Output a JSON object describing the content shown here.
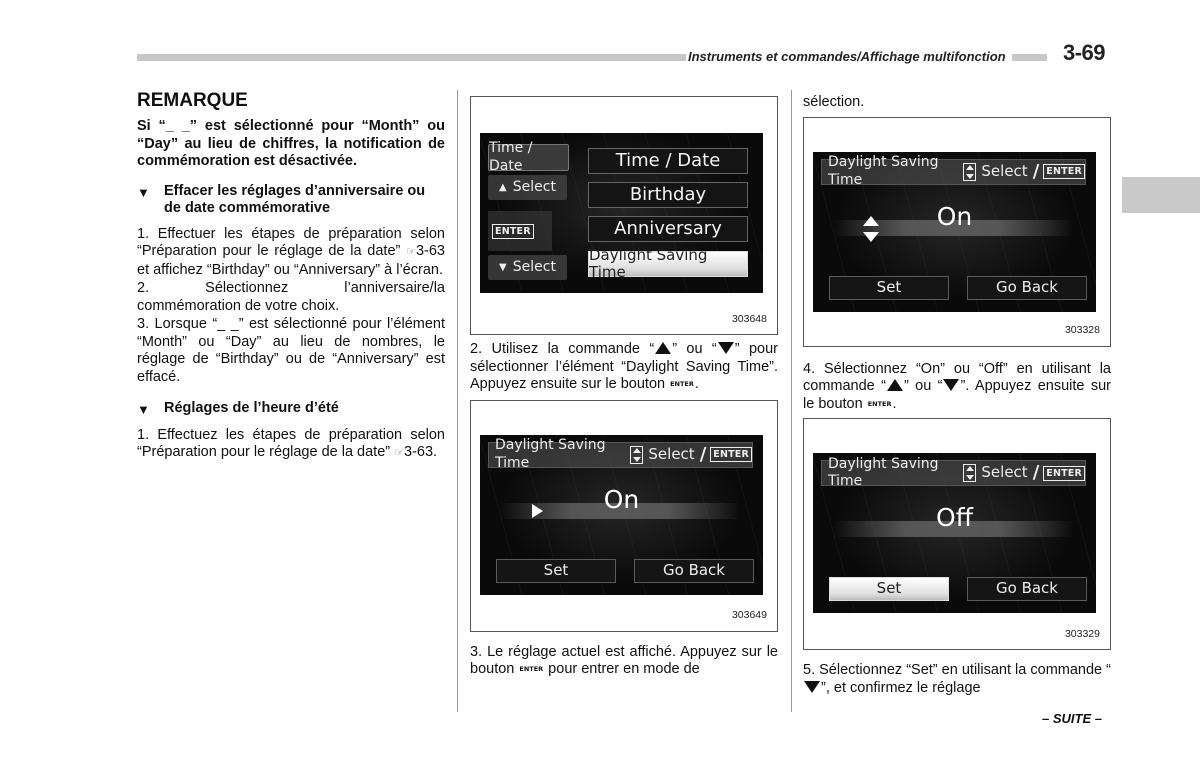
{
  "header": {
    "section_title": "Instruments et commandes/Affichage multifonction",
    "page_number": "3-69"
  },
  "left_column": {
    "remarque": {
      "title": "REMARQUE",
      "body": "Si “_ _” est sélectionné pour “Month” ou “Day” au lieu de chiffres, la notification de commémoration est désactivée."
    },
    "section1": {
      "marker": "▼",
      "title": "Effacer les réglages d’anniversaire ou de date commémorative",
      "steps": [
        {
          "pre": "1. Effectuer les étapes de préparation selon “Préparation pour le réglage de la date” ",
          "ref_icon": "☞",
          "ref": "3-63",
          "post": " et affichez “Birthday” ou “Anniversary” à l’écran."
        },
        {
          "text": "2. Sélectionnez l’anniversaire/la commémoration de votre choix."
        },
        {
          "text": "3. Lorsque “_ _” est sélectionné pour l’élément “Month” ou “Day” au lieu de nombres, le réglage de “Birthday” ou de “Anniversary” est effacé."
        }
      ]
    },
    "section2": {
      "marker": "▼",
      "title": "Réglages de l’heure d’été",
      "steps": [
        {
          "pre": "1. Effectuez les étapes de préparation selon “Préparation pour le réglage de la date” ",
          "ref_icon": "☞",
          "ref": "3-63",
          "post": "."
        }
      ]
    }
  },
  "figures": {
    "fig_303648": {
      "number": "303648",
      "left_panel": {
        "title": "Time / Date",
        "up_select": "Select",
        "enter": "ENTER",
        "down_select": "Select"
      },
      "menu_items": [
        "Time / Date",
        "Birthday",
        "Anniversary",
        "Daylight Saving Time"
      ],
      "selected_index": 3
    },
    "fig_303649": {
      "number": "303649",
      "header_label": "Daylight Saving Time",
      "select_label": "Select",
      "slash": "/",
      "enter": "ENTER",
      "value": "On",
      "indicator": "play-arrow",
      "set_label": "Set",
      "back_label": "Go Back",
      "active_button": "none"
    },
    "fig_303328": {
      "number": "303328",
      "header_label": "Daylight Saving Time",
      "select_label": "Select",
      "slash": "/",
      "enter": "ENTER",
      "value": "On",
      "indicator": "up-down-arrows",
      "set_label": "Set",
      "back_label": "Go Back",
      "active_button": "none"
    },
    "fig_303329": {
      "number": "303329",
      "header_label": "Daylight Saving Time",
      "select_label": "Select",
      "slash": "/",
      "enter": "ENTER",
      "value": "Off",
      "indicator": "none",
      "set_label": "Set",
      "back_label": "Go Back",
      "active_button": "set"
    }
  },
  "middle_column": {
    "step2": {
      "a": "2. Utilisez la commande “",
      "b": "” ou “",
      "c": "” pour sélectionner l’élément “Daylight Saving Time”. Appuyez ensuite sur le bouton ",
      "enter": "ENTER",
      "d": "."
    },
    "step3": {
      "a": "3. Le réglage actuel est affiché. Appuyez sur le bouton ",
      "enter": "ENTER",
      "b": " pour entrer en mode de"
    }
  },
  "right_column": {
    "continued": "sélection.",
    "step4": {
      "a": "4. Sélectionnez “On” ou “Off” en utilisant la commande “",
      "b": "” ou “",
      "c": "”. Appuyez ensuite sur le bouton ",
      "enter": "ENTER",
      "d": "."
    },
    "step5": {
      "a": "5. Sélectionnez “Set” en utilisant la commande “",
      "b": "”, et confirmez le réglage"
    }
  },
  "footer": {
    "continued_label": "– SUITE –"
  }
}
